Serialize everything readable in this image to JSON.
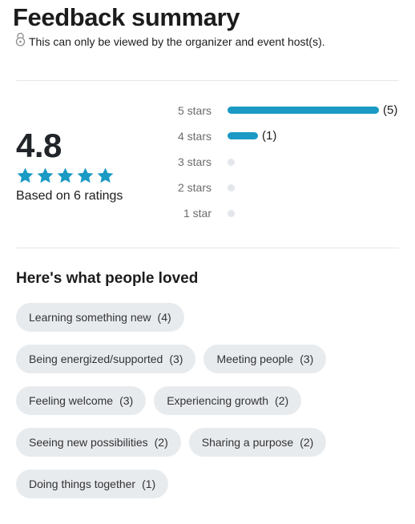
{
  "header": {
    "title": "Feedback summary",
    "privacy_note": "This can only be viewed by the organizer and event host(s)."
  },
  "summary": {
    "average": "4.8",
    "star_count": 5,
    "based_on": "Based on 6 ratings"
  },
  "distribution": [
    {
      "label": "5 stars",
      "count": 5,
      "count_text": "(5)"
    },
    {
      "label": "4 stars",
      "count": 1,
      "count_text": "(1)"
    },
    {
      "label": "3 stars",
      "count": 0,
      "count_text": ""
    },
    {
      "label": "2 stars",
      "count": 0,
      "count_text": ""
    },
    {
      "label": "1 star",
      "count": 0,
      "count_text": ""
    }
  ],
  "loved": {
    "heading": "Here's what people loved",
    "rows": [
      [
        {
          "label": "Learning something new",
          "count": "(4)"
        }
      ],
      [
        {
          "label": "Being energized/supported",
          "count": "(3)"
        },
        {
          "label": "Meeting people",
          "count": "(3)"
        }
      ],
      [
        {
          "label": "Feeling welcome",
          "count": "(3)"
        },
        {
          "label": "Experiencing growth",
          "count": "(2)"
        }
      ],
      [
        {
          "label": "Seeing new possibilities",
          "count": "(2)"
        },
        {
          "label": "Sharing a purpose",
          "count": "(2)"
        }
      ],
      [
        {
          "label": "Doing things together",
          "count": "(1)"
        }
      ]
    ]
  },
  "colors": {
    "accent": "#1a9ac4",
    "empty": "#e3e6ea",
    "chip": "#e8ebee"
  },
  "icons": {
    "privacy": "lock-icon",
    "rating": "star-icon"
  }
}
